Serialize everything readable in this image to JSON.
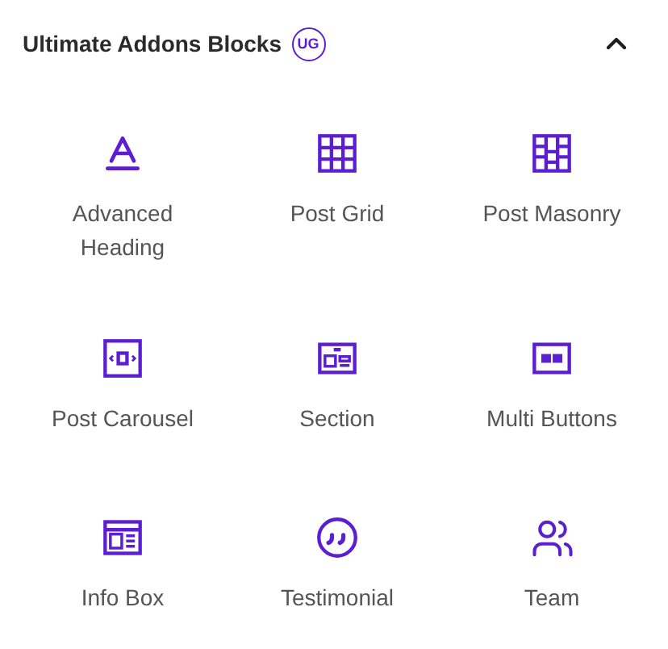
{
  "panel": {
    "title": "Ultimate Addons Blocks",
    "badge": "UG",
    "expanded": true
  },
  "blocks": [
    {
      "label": "Advanced Heading",
      "kind": "heading"
    },
    {
      "label": "Post Grid",
      "kind": "grid"
    },
    {
      "label": "Post Masonry",
      "kind": "masonry"
    },
    {
      "label": "Post Carousel",
      "kind": "carousel"
    },
    {
      "label": "Section",
      "kind": "section"
    },
    {
      "label": "Multi Buttons",
      "kind": "buttons"
    },
    {
      "label": "Info Box",
      "kind": "infobox"
    },
    {
      "label": "Testimonial",
      "kind": "testimonial"
    },
    {
      "label": "Team",
      "kind": "team"
    }
  ]
}
